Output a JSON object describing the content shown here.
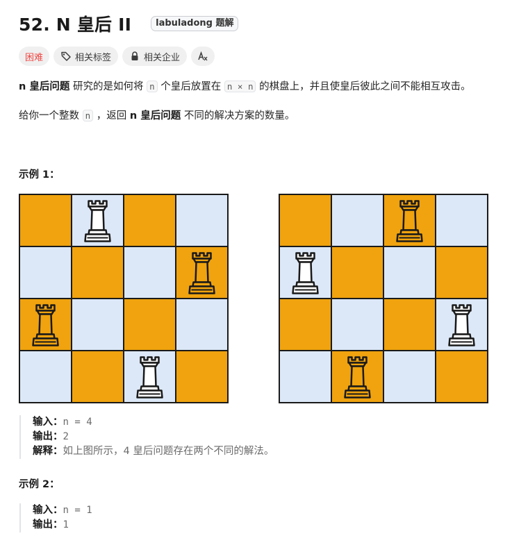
{
  "problem": {
    "title": "52. N 皇后 II",
    "badge": "labuladong 题解",
    "difficulty": "困难",
    "tag_related_topics": "相关标签",
    "tag_related_companies": "相关企业",
    "translate_icon": "A文"
  },
  "description": {
    "p1_bold": "n 皇后问题",
    "p1_a": " 研究的是如何将 ",
    "p1_code1": "n",
    "p1_b": " 个皇后放置在 ",
    "p1_code2": "n × n",
    "p1_c": " 的棋盘上，并且使皇后彼此之间不能相互攻击。",
    "p2_a": "给你一个整数 ",
    "p2_code": "n",
    "p2_b": " ，返回 ",
    "p2_bold": "n 皇后问题",
    "p2_c": " 不同的解决方案的数量。"
  },
  "example1": {
    "heading": "示例 1：",
    "boards": [
      {
        "queens": [
          1,
          3,
          0,
          2
        ]
      },
      {
        "queens": [
          2,
          0,
          3,
          1
        ]
      }
    ],
    "colors": {
      "orange": "#f0a30e",
      "light": "#dce8f8",
      "border": "#1a1a1a"
    },
    "input_label": "输入：",
    "input_value": "n = 4",
    "output_label": "输出：",
    "output_value": "2",
    "explain_label": "解释：",
    "explain_value": "如上图所示，4 皇后问题存在两个不同的解法。"
  },
  "example2": {
    "heading": "示例 2：",
    "input_label": "输入：",
    "input_value": "n = 1",
    "output_label": "输出：",
    "output_value": "1"
  }
}
